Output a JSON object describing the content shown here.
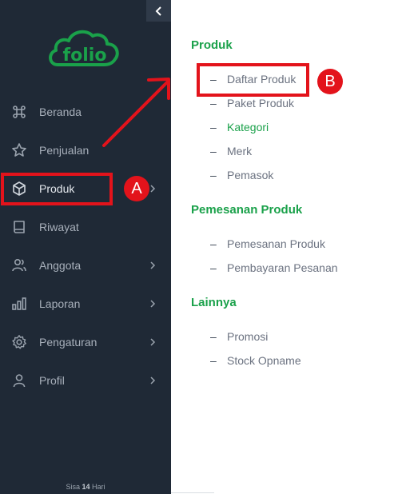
{
  "sidebar": {
    "logo_text": "folio",
    "items": [
      {
        "label": "Beranda",
        "icon": "command-icon",
        "chevron": false
      },
      {
        "label": "Penjualan",
        "icon": "star-icon",
        "chevron": false
      },
      {
        "label": "Produk",
        "icon": "box-icon",
        "chevron": true
      },
      {
        "label": "Riwayat",
        "icon": "book-icon",
        "chevron": false
      },
      {
        "label": "Anggota",
        "icon": "users-icon",
        "chevron": true
      },
      {
        "label": "Laporan",
        "icon": "bar-chart-icon",
        "chevron": true
      },
      {
        "label": "Pengaturan",
        "icon": "gear-icon",
        "chevron": true
      },
      {
        "label": "Profil",
        "icon": "user-icon",
        "chevron": true
      }
    ],
    "footer_prefix": "Sisa",
    "footer_days": "14",
    "footer_suffix": "Hari"
  },
  "submenu": {
    "sections": [
      {
        "title": "Produk",
        "items": [
          "Daftar Produk",
          "Paket Produk",
          "Kategori",
          "Merk",
          "Pemasok"
        ]
      },
      {
        "title": "Pemesanan Produk",
        "items": [
          "Pemesanan Produk",
          "Pembayaran Pesanan"
        ]
      },
      {
        "title": "Lainnya",
        "items": [
          "Promosi",
          "Stock Opname"
        ]
      }
    ],
    "dash": "–"
  },
  "annotations": {
    "a_label": "A",
    "b_label": "B",
    "color": "#e3131b"
  },
  "colors": {
    "sidebar_bg": "#1f2936",
    "accent_green": "#1aa14a"
  }
}
